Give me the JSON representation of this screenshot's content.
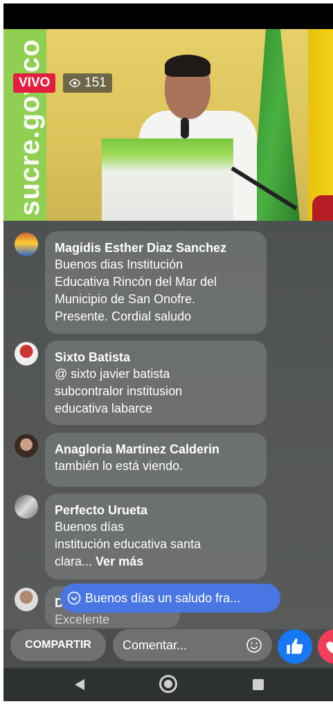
{
  "live": {
    "badge_label": "VIVO",
    "viewer_count": "151"
  },
  "video": {
    "wall_text": "sucre.gov.co"
  },
  "comments": [
    {
      "name": "Magidis Esther Diaz Sanchez",
      "lines": [
        "Buenos dias Institución",
        "Educativa Rincón del Mar del",
        "Municipio de San Onofre.",
        "Presente. Cordial saludo"
      ]
    },
    {
      "name": "Sixto Batista",
      "lines": [
        "@ sixto javier batista",
        "subcontralor institusion",
        "educativa labarce"
      ]
    },
    {
      "name": "Anagloria Martinez Calderin",
      "lines": [
        "también lo está viendo."
      ]
    },
    {
      "name": "Perfecto Urueta",
      "lines": [
        "Buenos días",
        "institución  educativa  santa"
      ],
      "last_line": "clara...",
      "see_more": "Ver más"
    },
    {
      "name": "D",
      "lines": [
        "Excelente"
      ]
    }
  ],
  "new_comment_popup": "Buenos días un saludo fra...",
  "actions": {
    "share_label": "COMPARTIR",
    "comment_placeholder": "Comentar..."
  },
  "icons": {
    "views": "eye-icon",
    "popup": "chevron-down-circle-icon",
    "emoji": "smiley-icon",
    "like": "thumbs-up-icon",
    "love": "heart-icon",
    "nav_back": "back-triangle-icon",
    "nav_home": "home-circle-icon",
    "nav_recent": "recent-square-icon"
  },
  "colors": {
    "live_red": "#e41e3f",
    "like_blue": "#1877f2",
    "popup_blue": "#4a76e3",
    "love_red": "#f33e58"
  }
}
